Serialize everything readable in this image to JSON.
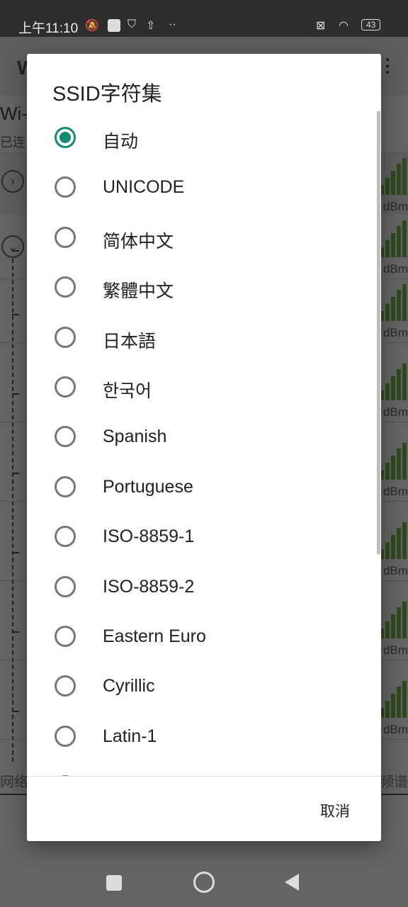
{
  "status_bar": {
    "time": "上午11:10",
    "battery": "43"
  },
  "background": {
    "app_title": "W",
    "section_title": "Wi-",
    "section_sub": "已连",
    "dbm": "dBm",
    "tab_left": "网络",
    "tab_right": "频谱"
  },
  "dialog": {
    "title": "SSID字符集",
    "selected_index": 0,
    "accent": "#138a72",
    "options": [
      "自动",
      "UNICODE",
      "简体中文",
      "繁體中文",
      "日本語",
      "한국어",
      "Spanish",
      "Portuguese",
      "ISO-8859-1",
      "ISO-8859-2",
      "Eastern Euro",
      "Cyrillic",
      "Latin-1"
    ],
    "cancel_label": "取消"
  }
}
